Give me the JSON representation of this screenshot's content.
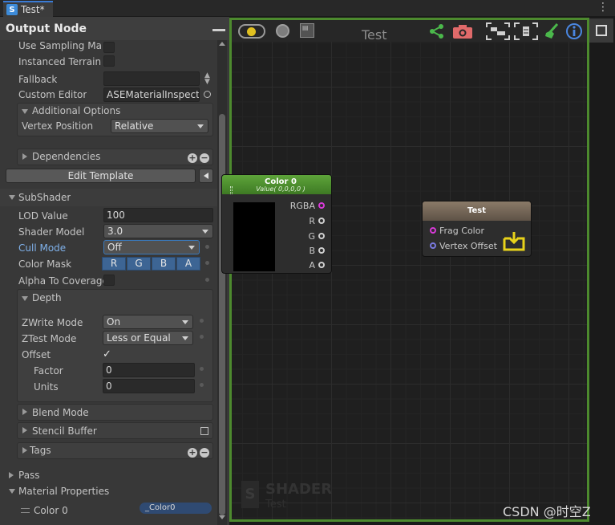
{
  "tab": {
    "icon": "S",
    "title": "Test*"
  },
  "panel": {
    "title": "Output Node",
    "rows": {
      "use_sampling": "Use Sampling Mac",
      "instanced_terrain": "Instanced Terrain",
      "fallback": "Fallback",
      "fallback_value": "",
      "custom_editor": "Custom Editor",
      "custom_editor_value": "ASEMaterialInspecto"
    },
    "additional_options": {
      "title": "Additional Options",
      "vertex_position_label": "Vertex Position",
      "vertex_position_value": "Relative"
    },
    "dependencies": "Dependencies",
    "edit_template": "Edit Template",
    "subshader": {
      "title": "SubShader",
      "lod_label": "LOD Value",
      "lod_value": "100",
      "shader_model_label": "Shader Model",
      "shader_model_value": "3.0",
      "cull_mode_label": "Cull Mode",
      "cull_mode_value": "Off",
      "color_mask_label": "Color Mask",
      "color_mask": [
        "R",
        "G",
        "B",
        "A"
      ],
      "alpha_to_coverage_label": "Alpha To Coverage"
    },
    "depth": {
      "title": "Depth",
      "zwrite_label": "ZWrite Mode",
      "zwrite_value": "On",
      "ztest_label": "ZTest Mode",
      "ztest_value": "Less or Equal",
      "offset_label": "Offset",
      "factor_label": "Factor",
      "factor_value": "0",
      "units_label": "Units",
      "units_value": "0"
    },
    "blend_mode": "Blend Mode",
    "stencil_buffer": "Stencil Buffer",
    "tags": "Tags",
    "pass": "Pass",
    "material_properties": "Material Properties",
    "color0_label": "Color 0",
    "color0_value": "_Color0"
  },
  "graph": {
    "title": "Test",
    "color_node": {
      "title": "Color 0",
      "subtitle": "Value( 0,0,0,0 )",
      "ports": [
        "RGBA",
        "R",
        "G",
        "B",
        "A"
      ]
    },
    "output_node": {
      "title": "Test",
      "ports": [
        "Frag Color",
        "Vertex Offset"
      ]
    },
    "watermark": {
      "title": "SHADER",
      "subtitle": "Test"
    },
    "colors": {
      "frame": "#4d8a2e",
      "port_rgba": "#d83ad8",
      "port_frag": "#d83ad8",
      "port_vertex": "#7a7ae0"
    }
  },
  "watermark_credit": "CSDN @时空Z"
}
